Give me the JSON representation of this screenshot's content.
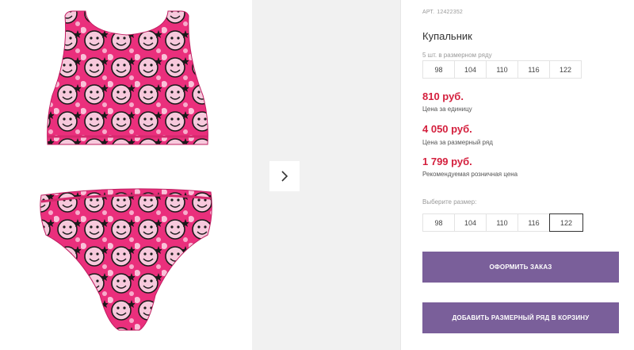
{
  "product": {
    "article_label": "АРТ.",
    "article_number": "12422352",
    "title": "Купальник"
  },
  "size_row": {
    "caption": "5 шт. в размерном ряду",
    "sizes": [
      "98",
      "104",
      "110",
      "116",
      "122"
    ]
  },
  "prices": {
    "unit": {
      "value": "810 руб.",
      "note": "Цена за единицу"
    },
    "row": {
      "value": "4 050 руб.",
      "note": "Цена за размерный ряд"
    },
    "retail": {
      "value": "1 799 руб.",
      "note": "Рекомендуемая розничная цена"
    },
    "color": "#d41f3d"
  },
  "size_select": {
    "label": "Выберите размер:",
    "sizes": [
      "98",
      "104",
      "110",
      "116",
      "122"
    ],
    "selected": "122"
  },
  "actions": {
    "order_label": "ОФОРМИТЬ ЗАКАЗ",
    "add_row_label": "ДОБАВИТЬ РАЗМЕРНЫЙ РЯД В КОРЗИНУ",
    "accent": "#7a5f9a"
  },
  "gallery": {
    "next_icon": "chevron-right-icon"
  }
}
